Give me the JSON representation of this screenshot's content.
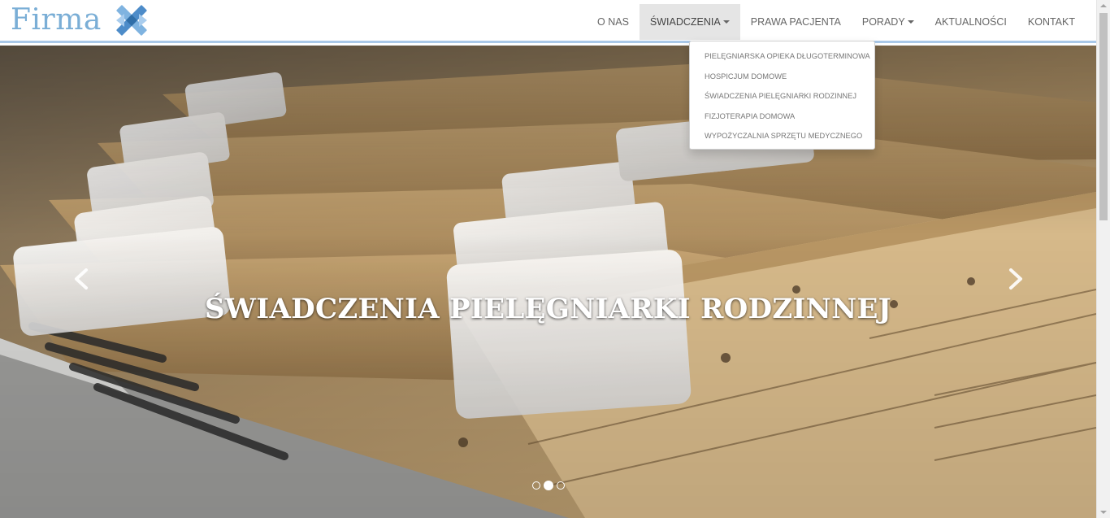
{
  "brand": {
    "name": "Firma",
    "logo_icon": "blue-cross-logo-icon"
  },
  "nav": {
    "items": [
      {
        "label": "O NAS",
        "has_caret": false,
        "active": false
      },
      {
        "label": "ŚWIADCZENIA",
        "has_caret": true,
        "active": true
      },
      {
        "label": "PRAWA PACJENTA",
        "has_caret": false,
        "active": false
      },
      {
        "label": "PORADY",
        "has_caret": true,
        "active": false
      },
      {
        "label": "AKTUALNOŚCI",
        "has_caret": false,
        "active": false
      },
      {
        "label": "KONTAKT",
        "has_caret": false,
        "active": false
      }
    ]
  },
  "dropdown": {
    "items": [
      "PIELĘGNIARSKA OPIEKA DŁUGOTERMINOWA",
      "HOSPICJUM DOMOWE",
      "ŚWIADCZENIA PIELĘGNIARKI RODZINNEJ",
      "FIZJOTERAPIA DOMOWA",
      "WYPOŻYCZALNIA SPRZĘTU MEDYCZNEGO"
    ]
  },
  "carousel": {
    "caption": "ŚWIADCZENIA PIELĘGNIARKI RODZINNEJ",
    "slide_count": 3,
    "active_slide": 2,
    "prev_icon": "chevron-left-icon",
    "next_icon": "chevron-right-icon",
    "image_subject": "hanging file folders with plastic tabs"
  },
  "colors": {
    "brand": "#7aaed6",
    "nav_active_bg": "#e5e5e5",
    "nav_border": "#a9c8e8"
  }
}
